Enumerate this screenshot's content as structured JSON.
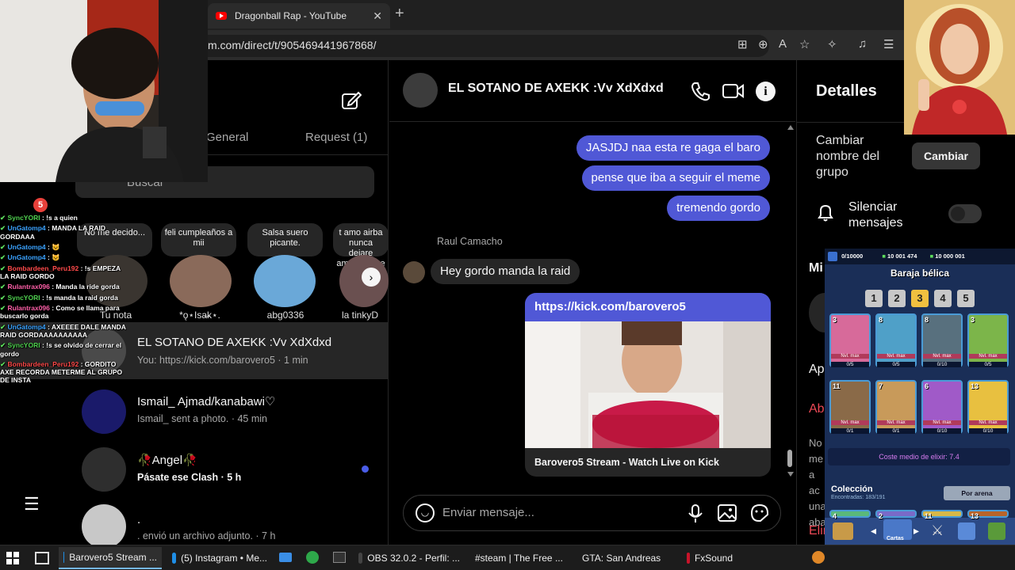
{
  "browser": {
    "tab_title": "Dragonball Rap - YouTube",
    "url": "m.com/direct/t/905469441967868/"
  },
  "inbox": {
    "tab_general": "General",
    "tab_request": "Request (1)",
    "search_placeholder": "Buscar",
    "notes": [
      {
        "text": "No me decido...",
        "name": "Tu nota"
      },
      {
        "text": "feli cumpleaños a mii",
        "name": "*ǫ⋆Isa̶k⋆."
      },
      {
        "text": "Salsa suero picante.",
        "name": "abg0336"
      },
      {
        "text": "t amo airba nunca dejare amarte , vue",
        "name": "la tinkyD"
      }
    ],
    "conversations": [
      {
        "title": "EL SOTANO DE AXEKK :Vv XdXdxd",
        "subtitle": "You: https://kick.com/barovero5 · 1 min"
      },
      {
        "title": "Ismail_ Ajmad/kanabawi♡",
        "subtitle": "Ismail_ sent a photo. · 45 min"
      },
      {
        "title": "🥀Angel🥀",
        "subtitle": "Pásate ese Clash · 5 h"
      },
      {
        "title": ".",
        "subtitle": ". envió un archivo adjunto. · 7 h"
      }
    ]
  },
  "chat": {
    "title": "EL SOTANO DE AXEKK :Vv XdXdxd",
    "messages_me": [
      "JASJDJ naa esta re gaga el baro",
      "pense que iba a seguir el meme",
      "tremendo gordo"
    ],
    "sender_name": "Raul Camacho",
    "message_them": "Hey gordo manda la raid",
    "link_url": "https://kick.com/barovero5",
    "link_caption": "Barovero5 Stream - Watch Live on Kick",
    "composer_placeholder": "Enviar mensaje..."
  },
  "details": {
    "title": "Detalles",
    "rename_label": "Cambiar nombre del grupo",
    "rename_button": "Cambiar",
    "mute_label": "Silenciar mensajes",
    "partial": [
      "Mi",
      "Ap",
      "Ab",
      "No",
      "me",
      "a ac",
      "una",
      "aba",
      "Elin"
    ]
  },
  "stream_chat": {
    "badge_count": "5",
    "lines": [
      {
        "user": "SyncYORI",
        "msg": ": !s a quien",
        "color": "#4fd14f"
      },
      {
        "user": "UnGatomp4",
        "msg": ": MANDA LA RAID GORDAAA",
        "color": "#3aa2ff"
      },
      {
        "user": "UnGatomp4",
        "msg": ": 😺",
        "color": "#3aa2ff"
      },
      {
        "user": "UnGatomp4",
        "msg": ": 😺",
        "color": "#3aa2ff"
      },
      {
        "user": "Bombardeen_Peru192",
        "msg": ": !s EMPEZA LA RAID GORDO",
        "color": "#ff4a4a"
      },
      {
        "user": "Rulantrax096",
        "msg": ": Manda la ride gorda",
        "color": "#ff5fa8"
      },
      {
        "user": "SyncYORI",
        "msg": ": !s manda la raid gorda",
        "color": "#4fd14f"
      },
      {
        "user": "Rulantrax096",
        "msg": ": Como se llama para buscarlo gorda",
        "color": "#ff5fa8"
      },
      {
        "user": "UnGatomp4",
        "msg": ": AXEEEE DALE MANDA RAID GORDAAAAAAAAAA",
        "color": "#3aa2ff"
      },
      {
        "user": "SyncYORI",
        "msg": ": !s se olvido de cerrar el gordo",
        "color": "#4fd14f"
      },
      {
        "user": "Bombardeen_Peru192",
        "msg": ": GORDITO AXE RECORDA METERME AL GRUPO DE INSTA",
        "color": "#ff4a4a"
      }
    ]
  },
  "clash": {
    "resource_1": "0/10000",
    "resource_2": "10 001 474",
    "resource_3": "10 000 001",
    "deck_title": "Baraja bélica",
    "deck_numbers": [
      "1",
      "2",
      "3",
      "4",
      "5"
    ],
    "selected_deck": "3",
    "cards": [
      {
        "level": "3",
        "count": "0/5",
        "color": "#d76a9a"
      },
      {
        "level": "8",
        "count": "0/5",
        "color": "#4fa0c8"
      },
      {
        "level": "8",
        "count": "0/10",
        "color": "#58707e"
      },
      {
        "level": "3",
        "count": "0/5",
        "color": "#7cb54a"
      },
      {
        "level": "11",
        "count": "0/1",
        "color": "#8a6a48"
      },
      {
        "level": "7",
        "count": "0/1",
        "color": "#c89a5a"
      },
      {
        "level": "6",
        "count": "0/10",
        "color": "#a05ac8"
      },
      {
        "level": "13",
        "count": "0/10",
        "color": "#e8c040"
      }
    ],
    "card_label": "Nvl. max",
    "elixir": "Coste medio de elixir: 7.4",
    "collection": "Colección",
    "found": "Encontradas: 183/191",
    "arena_button": "Por arena",
    "collection_levels": [
      "4",
      "2",
      "11",
      "13"
    ],
    "nav_label": "Cartas"
  },
  "taskbar": [
    {
      "label": "Barovero5 Stream ...",
      "color": "#1f8ee6",
      "active": true
    },
    {
      "label": "(5) Instagram • Me...",
      "color": "#1f8ee6",
      "active": false
    },
    {
      "label": "OBS 32.0.2 - Perfil: ...",
      "color": "#444",
      "active": false
    },
    {
      "label": "#steam | The Free ...",
      "color": "#5865f2",
      "active": false
    },
    {
      "label": "GTA: San Andreas",
      "color": "#7a5a2a",
      "active": false
    },
    {
      "label": "FxSound",
      "color": "#c8142a",
      "active": false
    }
  ],
  "colors": {
    "accent": "#5058d6",
    "surface": "#262626",
    "bg": "#000000"
  }
}
